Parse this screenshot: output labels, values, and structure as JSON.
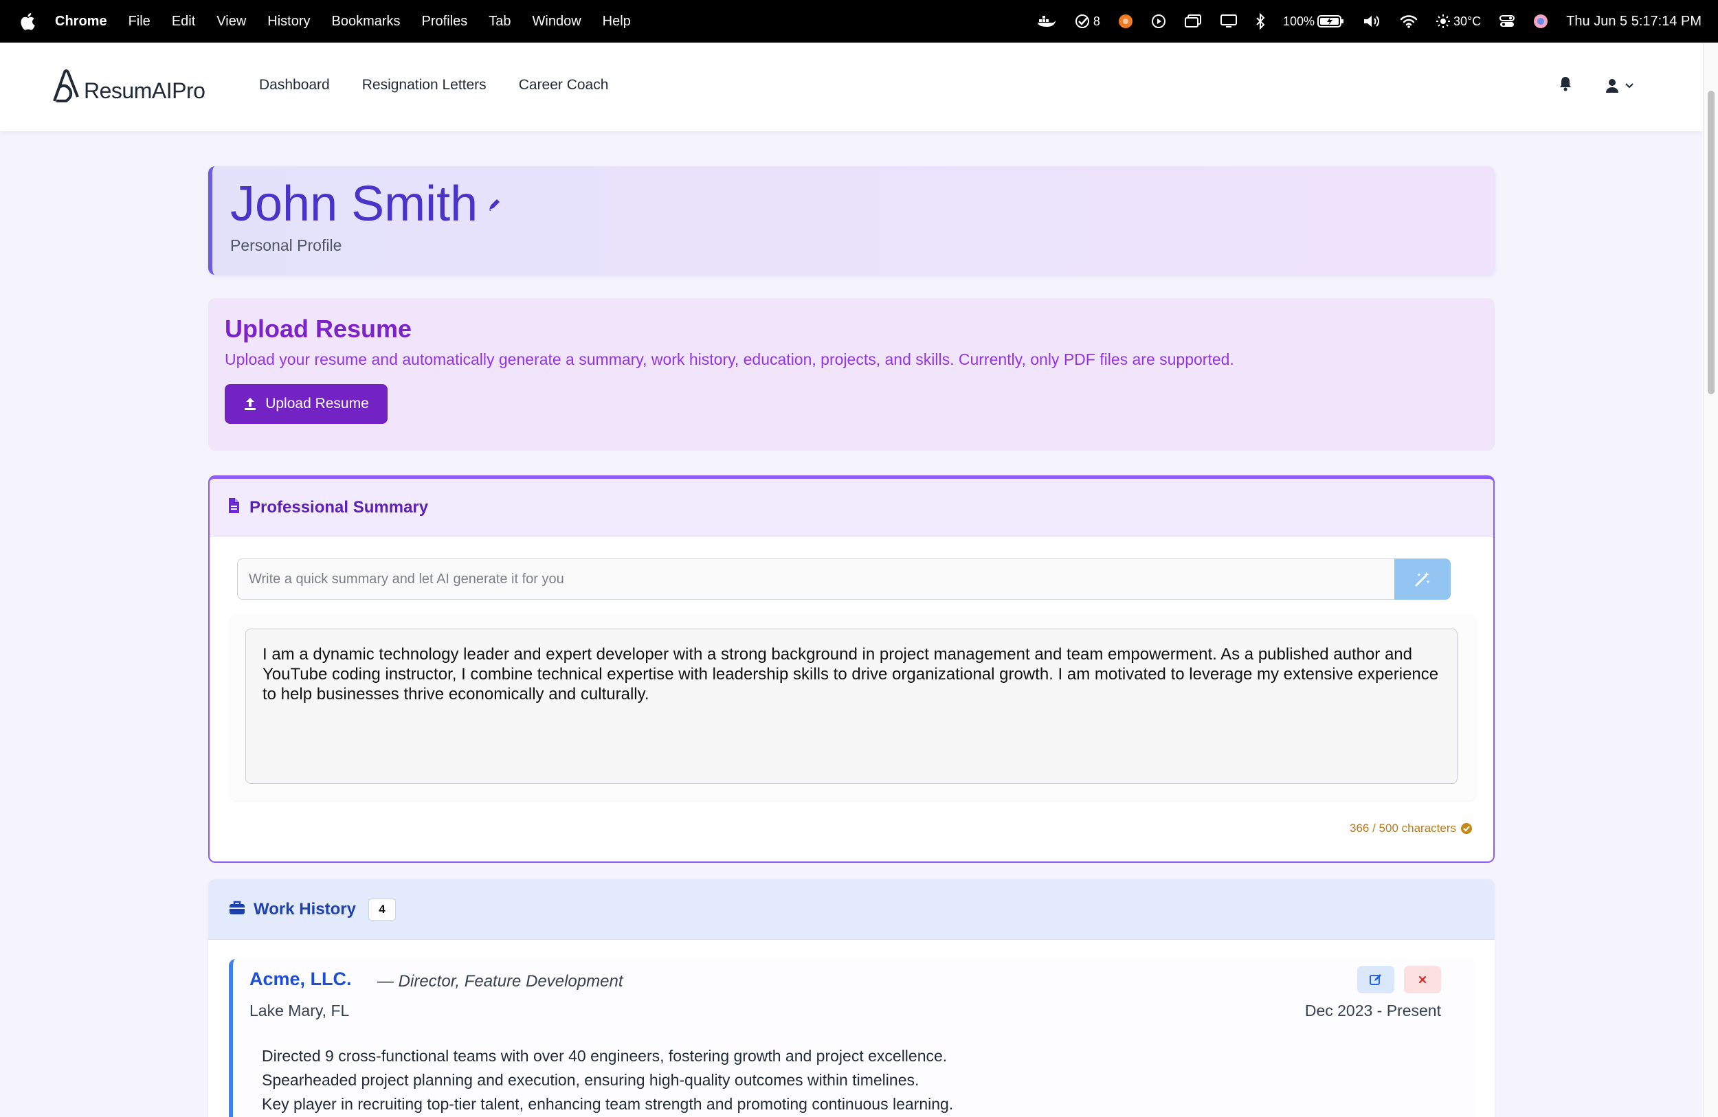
{
  "menubar": {
    "app_name": "Chrome",
    "items": [
      "File",
      "Edit",
      "View",
      "History",
      "Bookmarks",
      "Profiles",
      "Tab",
      "Window",
      "Help"
    ],
    "tasks_count": "8",
    "battery": "100%",
    "weather": "30°C",
    "datetime": "Thu Jun 5  5:17:14 PM"
  },
  "header": {
    "logo_text": "ResumAIPro",
    "nav": [
      "Dashboard",
      "Resignation Letters",
      "Career Coach"
    ]
  },
  "profile": {
    "name": "John Smith",
    "subtitle": "Personal Profile"
  },
  "upload": {
    "title": "Upload Resume",
    "description": "Upload your resume and automatically generate a summary, work history, education, projects, and skills. Currently, only PDF files are supported.",
    "button_label": "Upload Resume"
  },
  "summary": {
    "title": "Professional Summary",
    "ai_placeholder": "Write a quick summary and let AI generate it for you",
    "text": "I am a dynamic technology leader and expert developer with a strong background in project management and team empowerment. As a published author and YouTube coding instructor, I combine technical expertise with leadership skills to drive organizational growth. I am motivated to leverage my extensive experience to help businesses thrive economically and culturally.",
    "char_count": "366 / 500 characters"
  },
  "work": {
    "title": "Work History",
    "count": "4",
    "jobs": [
      {
        "company": "Acme, LLC.",
        "role": "— Director, Feature Development",
        "location": "Lake Mary, FL",
        "dates": "Dec 2023 - Present",
        "bullets": [
          "Directed 9 cross-functional teams with over 40 engineers, fostering growth and project excellence.",
          "Spearheaded project planning and execution, ensuring high-quality outcomes within timelines.",
          "Key player in recruiting top-tier talent, enhancing team strength and promoting continuous learning."
        ]
      }
    ]
  },
  "colors": {
    "brand_purple": "#7322c4",
    "name_indigo": "#4a34c8",
    "work_blue": "#1d4ed8"
  }
}
